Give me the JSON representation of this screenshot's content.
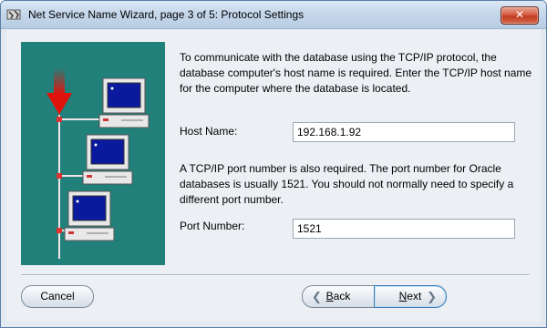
{
  "window": {
    "title": "Net Service Name Wizard, page 3 of 5: Protocol Settings",
    "close_label": "✕"
  },
  "content": {
    "intro_text": "To communicate with the database using the TCP/IP protocol, the database computer's host name is required.  Enter the TCP/IP host name for the computer where the database is located.",
    "host_label": "Host Name:",
    "host_value": "192.168.1.92",
    "port_intro_text": "A TCP/IP port number is also required.  The port number for Oracle databases is usually 1521.  You should not normally need to specify a different port number.",
    "port_label": "Port Number:",
    "port_value": "1521"
  },
  "buttons": {
    "cancel": "Cancel",
    "back_mnemonic": "B",
    "back_rest": "ack",
    "next_mnemonic": "N",
    "next_rest": "ext"
  },
  "colors": {
    "illustration_bg": "#22807a",
    "arrow": "#e0120c"
  },
  "icons": {
    "app": "wizard-app-icon",
    "back": "chevron-left-icon",
    "next": "chevron-right-icon",
    "illustration": "networked-computers-illustration"
  }
}
